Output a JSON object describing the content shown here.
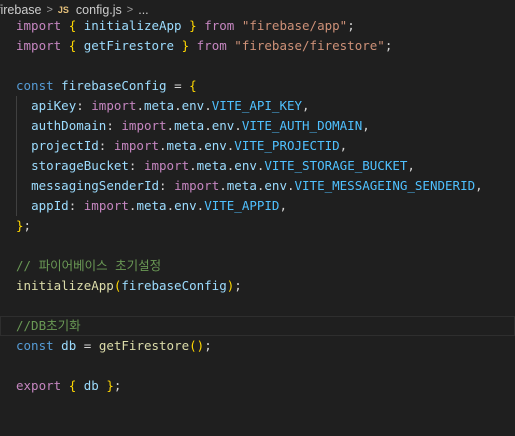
{
  "breadcrumb": {
    "folder": "firebase",
    "file_icon": "JS",
    "file": "config.js",
    "ellipsis": "..."
  },
  "code": {
    "l1": {
      "kw": "import",
      "b1": "{",
      "name": "initializeApp",
      "b2": "}",
      "from": "from",
      "src": "\"firebase/app\"",
      "end": ";"
    },
    "l2": {
      "kw": "import",
      "b1": "{",
      "name": "getFirestore",
      "b2": "}",
      "from": "from",
      "src": "\"firebase/firestore\"",
      "end": ";"
    },
    "l4": {
      "kw": "const",
      "name": "firebaseConfig",
      "eq": "=",
      "b": "{"
    },
    "props": [
      {
        "key": "apiKey",
        "env": "VITE_API_KEY"
      },
      {
        "key": "authDomain",
        "env": "VITE_AUTH_DOMAIN"
      },
      {
        "key": "projectId",
        "env": "VITE_PROJECTID"
      },
      {
        "key": "storageBucket",
        "env": "VITE_STORAGE_BUCKET"
      },
      {
        "key": "messagingSenderId",
        "env": "VITE_MESSAGEING_SENDERID"
      },
      {
        "key": "appId",
        "env": "VITE_APPID"
      }
    ],
    "import_kw": "import",
    "meta": "meta",
    "envword": "env",
    "l11": {
      "b": "}",
      "end": ";"
    },
    "comment1": "// 파이어베이스 초기설정",
    "l14": {
      "fn": "initializeApp",
      "arg": "firebaseConfig",
      "end": ");"
    },
    "comment2": "//DB초기화",
    "l17": {
      "kw": "const",
      "name": "db",
      "eq": "=",
      "fn": "getFirestore",
      "call": "()",
      "end": ";"
    },
    "l19": {
      "kw": "export",
      "b1": "{",
      "name": "db",
      "b2": "}",
      "end": ";"
    }
  }
}
